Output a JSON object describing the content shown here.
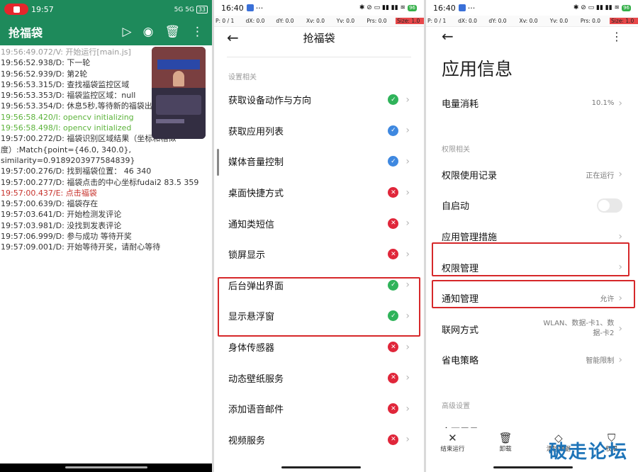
{
  "panel1": {
    "status": {
      "time": "19:57",
      "right": "5G 5G",
      "battery": "33"
    },
    "app_title": "抢福袋",
    "logs": [
      {
        "t": "19:56:49.072/V: 开始运行[main.js]",
        "c": "gray"
      },
      {
        "t": "19:56:52.938/D: 下一轮",
        "c": ""
      },
      {
        "t": "19:56:52.939/D: 第2轮",
        "c": ""
      },
      {
        "t": "19:56:53.315/D: 查找福袋监控区域",
        "c": ""
      },
      {
        "t": "19:56:53.353/D: 福袋监控区域：null",
        "c": ""
      },
      {
        "t": "19:56:53.354/D: 休息5秒,等待新的福袋出现",
        "c": ""
      },
      {
        "t": "19:56:58.420/I: opencv initializing",
        "c": "green"
      },
      {
        "t": "19:56:58.498/I: opencv initialized",
        "c": "green"
      },
      {
        "t": "19:57:00.272/D: 福袋识别区域结果（坐标和相似度）:Match{point={46.0, 340.0}, similarity=0.9189203977584839}",
        "c": "wrap"
      },
      {
        "t": "19:57:00.276/D: 找到福袋位置：  46 340",
        "c": ""
      },
      {
        "t": "19:57:00.277/D: 福袋点击的中心坐标fudai2 83.5 359",
        "c": ""
      },
      {
        "t": "19:57:00.437/E: 点击福袋",
        "c": "red"
      },
      {
        "t": "19:57:00.639/D: 福袋存在",
        "c": ""
      },
      {
        "t": "19:57:03.641/D: 开始检测发评论",
        "c": ""
      },
      {
        "t": "19:57:03.981/D: 没找到发表评论",
        "c": ""
      },
      {
        "t": "19:57:06.999/D: 参与成功 等待开奖",
        "c": ""
      },
      {
        "t": "19:57:09.001/D: 开始等待开奖，请耐心等待",
        "c": ""
      }
    ]
  },
  "coords": {
    "p": "P: 0 / 1",
    "dx": "dX: 0.0",
    "dy": "dY: 0.0",
    "xv": "Xv: 0.0",
    "yv": "Yv: 0.0",
    "prs": "Prs: 0.0",
    "size": "Size: 1.0"
  },
  "panel2": {
    "status": {
      "time": "16:40",
      "battery": "96"
    },
    "title": "抢福袋",
    "section": "设置相关",
    "items": [
      {
        "label": "获取设备动作与方向",
        "status": "ok"
      },
      {
        "label": "获取应用列表",
        "status": "shield"
      },
      {
        "label": "媒体音量控制",
        "status": "shield"
      },
      {
        "label": "桌面快捷方式",
        "status": "no"
      },
      {
        "label": "通知类短信",
        "status": "no"
      },
      {
        "label": "锁屏显示",
        "status": "no"
      },
      {
        "label": "后台弹出界面",
        "status": "ok"
      },
      {
        "label": "显示悬浮窗",
        "status": "ok"
      },
      {
        "label": "身体传感器",
        "status": "no"
      },
      {
        "label": "动态壁纸服务",
        "status": "no"
      },
      {
        "label": "添加语音邮件",
        "status": "no"
      },
      {
        "label": "视频服务",
        "status": "no"
      }
    ]
  },
  "panel3": {
    "status": {
      "time": "16:40",
      "battery": "96"
    },
    "page_title": "应用信息",
    "battery_row": {
      "label": "电量消耗",
      "value": "10.1%"
    },
    "section1": "权限相关",
    "rows": [
      {
        "label": "权限使用记录",
        "value": "正在运行"
      },
      {
        "label": "自启动",
        "value": ""
      },
      {
        "label": "应用管理措施",
        "value": ""
      },
      {
        "label": "权限管理",
        "value": ""
      },
      {
        "label": "通知管理",
        "value": "允许"
      },
      {
        "label": "联网方式",
        "value": "WLAN、数据-卡1、数据-卡2"
      },
      {
        "label": "省电策略",
        "value": "智能限制"
      }
    ],
    "section2": "高级设置",
    "fullscreen": "全面屏显示",
    "bottom": [
      {
        "label": "结束运行",
        "icon": "close-icon"
      },
      {
        "label": "卸载",
        "icon": "trash-icon"
      },
      {
        "label": "清除数据",
        "icon": "eraser-icon"
      },
      {
        "label": "权限",
        "icon": "shield-icon"
      }
    ]
  },
  "watermark": "破走论坛"
}
